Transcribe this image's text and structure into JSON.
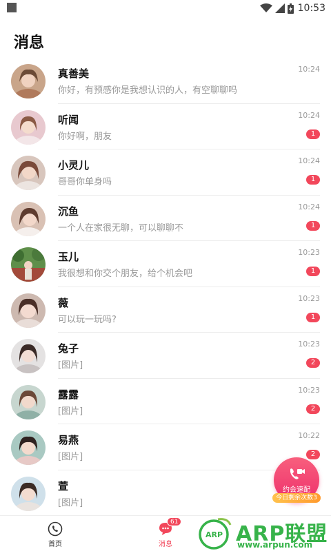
{
  "status_bar": {
    "time": "10:53"
  },
  "header": {
    "title": "消息"
  },
  "conversations": [
    {
      "name": "真善美",
      "preview": "你好，有预感你是我想认识的人，有空聊聊吗",
      "time": "10:24",
      "unread": ""
    },
    {
      "name": "听闻",
      "preview": "你好啊，朋友",
      "time": "10:24",
      "unread": "1"
    },
    {
      "name": "小灵儿",
      "preview": "哥哥你单身吗",
      "time": "10:24",
      "unread": "1"
    },
    {
      "name": "沉鱼",
      "preview": "一个人在家很无聊，可以聊聊不",
      "time": "10:24",
      "unread": "1"
    },
    {
      "name": "玉儿",
      "preview": "我很想和你交个朋友，给个机会吧",
      "time": "10:23",
      "unread": "1"
    },
    {
      "name": "薇",
      "preview": "可以玩一玩吗?",
      "time": "10:23",
      "unread": "1"
    },
    {
      "name": "兔子",
      "preview": "[图片]",
      "time": "10:23",
      "unread": "2"
    },
    {
      "name": "露露",
      "preview": "[图片]",
      "time": "10:23",
      "unread": "2"
    },
    {
      "name": "易燕",
      "preview": "[图片]",
      "time": "10:22",
      "unread": "2"
    },
    {
      "name": "萱",
      "preview": "[图片]",
      "time": "",
      "unread": ""
    }
  ],
  "fab": {
    "label": "约会速配",
    "sub_label": "今日剩余次数3"
  },
  "bottom_nav": {
    "home_label": "首页",
    "messages_label": "消息",
    "messages_badge": "61"
  },
  "watermark": {
    "text": "ARP联盟",
    "url": "www.arpun.com"
  },
  "colors": {
    "accent": "#f2475b",
    "fab_gradient_start": "#f85f7d",
    "watermark": "#37b34a"
  }
}
